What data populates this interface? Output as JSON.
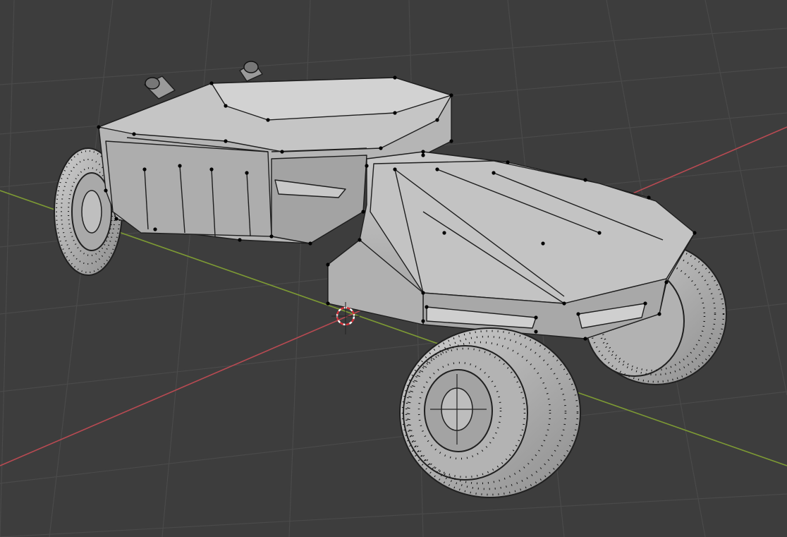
{
  "viewport": {
    "mode": "edit-mode",
    "object": "low-poly-buggy-mesh",
    "background_color": "#3d3d3d",
    "grid_color": "#4a4a4a",
    "x_axis_color": "#b84a52",
    "y_axis_color": "#7d9a34",
    "mesh_face_color": "#b9b9b9",
    "mesh_edge_color": "#1a1a1a",
    "vertex_color": "#000000",
    "cursor_icon": "3d-cursor-icon"
  }
}
